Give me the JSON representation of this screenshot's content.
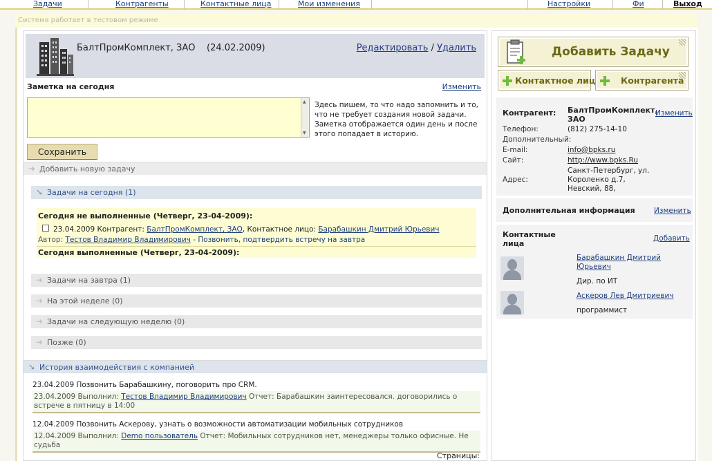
{
  "nav": {
    "tasks": "Задачи",
    "contractors": "Контрагенты",
    "contacts": "Контактные лица",
    "my_changes": "Мои изменения",
    "settings": "Настройки",
    "user": "Фи",
    "logout": "Выход"
  },
  "test_banner": "Система работает в тестовом режиме",
  "company": {
    "name": "БалтПромКомплект, ЗАО",
    "date": "(24.02.2009)",
    "edit": "Редактировать",
    "separator": "/",
    "delete": "Удалить"
  },
  "note": {
    "title": "Заметка на сегодня",
    "edit": "Изменить",
    "value": "",
    "help": "Здесь пишем, то что надо запомнить и то, что не требует создания новой задачи. Заметка отображается один день и после этого попадает в историю.",
    "save": "Сохранить"
  },
  "add_task_bar": "Добавить новую задачу",
  "sections": {
    "today": "Задачи на сегодня (1)",
    "tomorrow": "Задачи на завтра (1)",
    "this_week": "На этой неделе (0)",
    "next_week": "Задачи на следующую неделю (0)",
    "later": "Позже (0)"
  },
  "today_box": {
    "not_done": "Сегодня не выполненные (Четверг, 23-04-2009):",
    "task": {
      "date_prefix": "23.04.2009 Контрагент:",
      "contractor": "БалтПромКомплект, ЗАО",
      "contact_prefix": ", Контактное лицо:",
      "contact": "Барабашкин Дмитрий Юрьевич",
      "author_prefix": "Автор:",
      "author": "Тестов Владимир Владимирович",
      "description": " - Позвонить, подтвердить встречу на завтра"
    },
    "done": "Сегодня выполненные (Четверг, 23-04-2009):"
  },
  "history": {
    "title": "История взаимодействия с компанией",
    "items": [
      {
        "title": "23.04.2009 Позвонить Барабашкину, поговорить про CRM.",
        "done_prefix": "23.04.2009 Выполнил:",
        "user": "Тестов Владимир Владимирович",
        "report": " Отчет: Барабашкин заинтересовался. договорились о встрече в пятницу в 14:00"
      },
      {
        "title": "12.04.2009 Позвонить Аскерову, узнать о возможности автоматизации мобильных сотрудников",
        "done_prefix": "12.04.2009 Выполнил:",
        "user": "Demo пользователь",
        "report": " Отчет: Мобильных сотрудников нет, менеджеры только офисные. Не судьба"
      }
    ],
    "pages_label": "Страницы:"
  },
  "right": {
    "add_task": "Добавить Задачу",
    "add_contact": "Контактное лицо",
    "add_contractor": "Контрагента",
    "info": {
      "contractor_label": "Контрагент:",
      "contractor_value": "БалтПромКомплект, ЗАО",
      "edit": "Изменить",
      "phone_label": "Телефон:",
      "phone": "(812) 275-14-10",
      "extra_label": "Дополнительный:",
      "email_label": "E-mail:",
      "email": "info@bpks.ru",
      "site_label": "Сайт:",
      "site": "http://www.bpks.Ru",
      "address_label": "Адрес:",
      "address": "Санкт-Петербург, ул. Короленко д.7, Невский, 88,"
    },
    "additional": {
      "title": "Дополнительная информация",
      "edit": "Изменить"
    },
    "contacts": {
      "title": "Контактные лица",
      "add": "Добавить",
      "items": [
        {
          "name": "Барабашкин Дмитрий Юрьевич",
          "role": "Дир. по ИТ"
        },
        {
          "name": "Аскеров Лев Дмитриевич",
          "role": "программист"
        }
      ]
    }
  },
  "colors": {
    "accent_yellow": "#fdfcd3",
    "section_blue": "#dde4ec",
    "link": "#1f3f7f",
    "button_text": "#6b6a14",
    "plus_green": "#6fbb3a"
  }
}
